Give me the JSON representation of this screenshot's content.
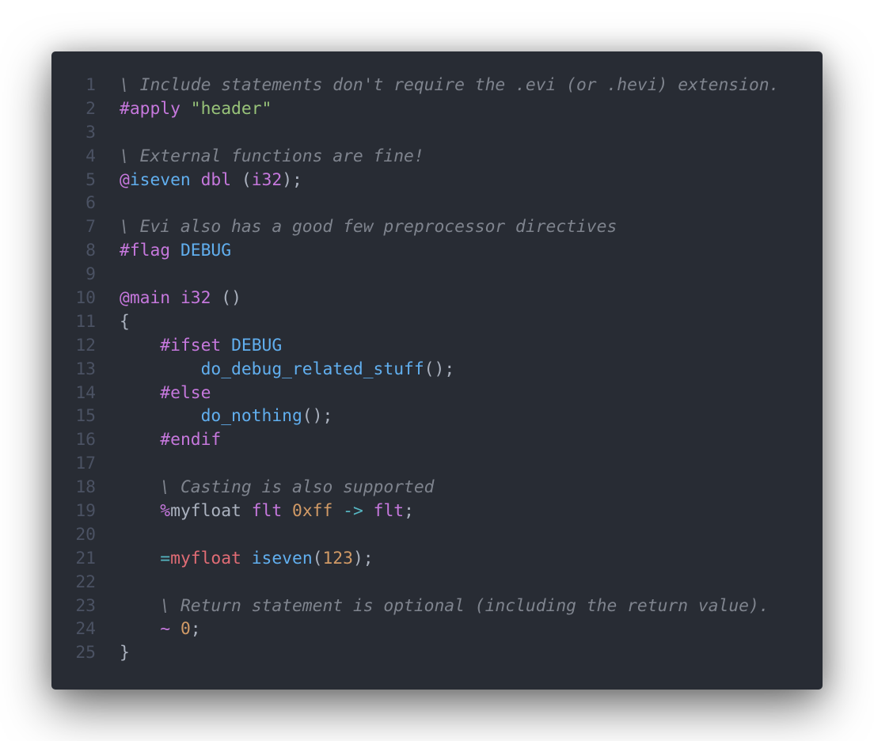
{
  "editor": {
    "lines": [
      {
        "number": "1",
        "tokens": [
          {
            "t": "\\ Include statements don't require the .evi (or .hevi) extension.",
            "c": "comment"
          }
        ]
      },
      {
        "number": "2",
        "tokens": [
          {
            "t": "#apply",
            "c": "directive"
          },
          {
            "t": " ",
            "c": "plain"
          },
          {
            "t": "\"header\"",
            "c": "string"
          }
        ]
      },
      {
        "number": "3",
        "tokens": []
      },
      {
        "number": "4",
        "tokens": [
          {
            "t": "\\ External functions are fine!",
            "c": "comment"
          }
        ]
      },
      {
        "number": "5",
        "tokens": [
          {
            "t": "@",
            "c": "at"
          },
          {
            "t": "iseven",
            "c": "func"
          },
          {
            "t": " ",
            "c": "plain"
          },
          {
            "t": "dbl",
            "c": "type"
          },
          {
            "t": " (",
            "c": "plain"
          },
          {
            "t": "i32",
            "c": "type"
          },
          {
            "t": ");",
            "c": "plain"
          }
        ]
      },
      {
        "number": "6",
        "tokens": []
      },
      {
        "number": "7",
        "tokens": [
          {
            "t": "\\ Evi also has a good few preprocessor directives",
            "c": "comment"
          }
        ]
      },
      {
        "number": "8",
        "tokens": [
          {
            "t": "#flag",
            "c": "directive"
          },
          {
            "t": " ",
            "c": "plain"
          },
          {
            "t": "DEBUG",
            "c": "const"
          }
        ]
      },
      {
        "number": "9",
        "tokens": []
      },
      {
        "number": "10",
        "tokens": [
          {
            "t": "@",
            "c": "at"
          },
          {
            "t": "main",
            "c": "type"
          },
          {
            "t": " ",
            "c": "plain"
          },
          {
            "t": "i32",
            "c": "type"
          },
          {
            "t": " ()",
            "c": "plain"
          }
        ]
      },
      {
        "number": "11",
        "tokens": [
          {
            "t": "{",
            "c": "plain"
          }
        ]
      },
      {
        "number": "12",
        "tokens": [
          {
            "t": "    ",
            "c": "plain"
          },
          {
            "t": "#ifset",
            "c": "directive"
          },
          {
            "t": " ",
            "c": "plain"
          },
          {
            "t": "DEBUG",
            "c": "const"
          }
        ]
      },
      {
        "number": "13",
        "tokens": [
          {
            "t": "        ",
            "c": "plain"
          },
          {
            "t": "do_debug_related_stuff",
            "c": "func"
          },
          {
            "t": "();",
            "c": "plain"
          }
        ]
      },
      {
        "number": "14",
        "tokens": [
          {
            "t": "    ",
            "c": "plain"
          },
          {
            "t": "#else",
            "c": "directive"
          }
        ]
      },
      {
        "number": "15",
        "tokens": [
          {
            "t": "        ",
            "c": "plain"
          },
          {
            "t": "do_nothing",
            "c": "func"
          },
          {
            "t": "();",
            "c": "plain"
          }
        ]
      },
      {
        "number": "16",
        "tokens": [
          {
            "t": "    ",
            "c": "plain"
          },
          {
            "t": "#endif",
            "c": "directive"
          }
        ]
      },
      {
        "number": "17",
        "tokens": []
      },
      {
        "number": "18",
        "tokens": [
          {
            "t": "    ",
            "c": "plain"
          },
          {
            "t": "\\ Casting is also supported",
            "c": "comment"
          }
        ]
      },
      {
        "number": "19",
        "tokens": [
          {
            "t": "    ",
            "c": "plain"
          },
          {
            "t": "%",
            "c": "percent"
          },
          {
            "t": "myfloat",
            "c": "plain"
          },
          {
            "t": " ",
            "c": "plain"
          },
          {
            "t": "flt",
            "c": "type"
          },
          {
            "t": " ",
            "c": "plain"
          },
          {
            "t": "0xff",
            "c": "number"
          },
          {
            "t": " ",
            "c": "plain"
          },
          {
            "t": "->",
            "c": "operator"
          },
          {
            "t": " ",
            "c": "plain"
          },
          {
            "t": "flt",
            "c": "type"
          },
          {
            "t": ";",
            "c": "plain"
          }
        ]
      },
      {
        "number": "20",
        "tokens": []
      },
      {
        "number": "21",
        "tokens": [
          {
            "t": "    ",
            "c": "plain"
          },
          {
            "t": "=",
            "c": "operator"
          },
          {
            "t": "myfloat",
            "c": "var"
          },
          {
            "t": " ",
            "c": "plain"
          },
          {
            "t": "iseven",
            "c": "func"
          },
          {
            "t": "(",
            "c": "plain"
          },
          {
            "t": "123",
            "c": "number"
          },
          {
            "t": ");",
            "c": "plain"
          }
        ]
      },
      {
        "number": "22",
        "tokens": []
      },
      {
        "number": "23",
        "tokens": [
          {
            "t": "    ",
            "c": "plain"
          },
          {
            "t": "\\ Return statement is optional (including the return value).",
            "c": "comment"
          }
        ]
      },
      {
        "number": "24",
        "tokens": [
          {
            "t": "    ",
            "c": "plain"
          },
          {
            "t": "~",
            "c": "tilde"
          },
          {
            "t": " ",
            "c": "plain"
          },
          {
            "t": "0",
            "c": "number"
          },
          {
            "t": ";",
            "c": "plain"
          }
        ]
      },
      {
        "number": "25",
        "tokens": [
          {
            "t": "}",
            "c": "plain"
          }
        ]
      }
    ]
  },
  "colors": {
    "background": "#282c34",
    "gutter": "#4b5263",
    "comment": "#7f848e",
    "keyword": "#c678dd",
    "string": "#98c379",
    "function": "#61afef",
    "number": "#d19a66",
    "operator": "#56b6c2",
    "variable": "#e06c75",
    "plain": "#abb2bf"
  }
}
